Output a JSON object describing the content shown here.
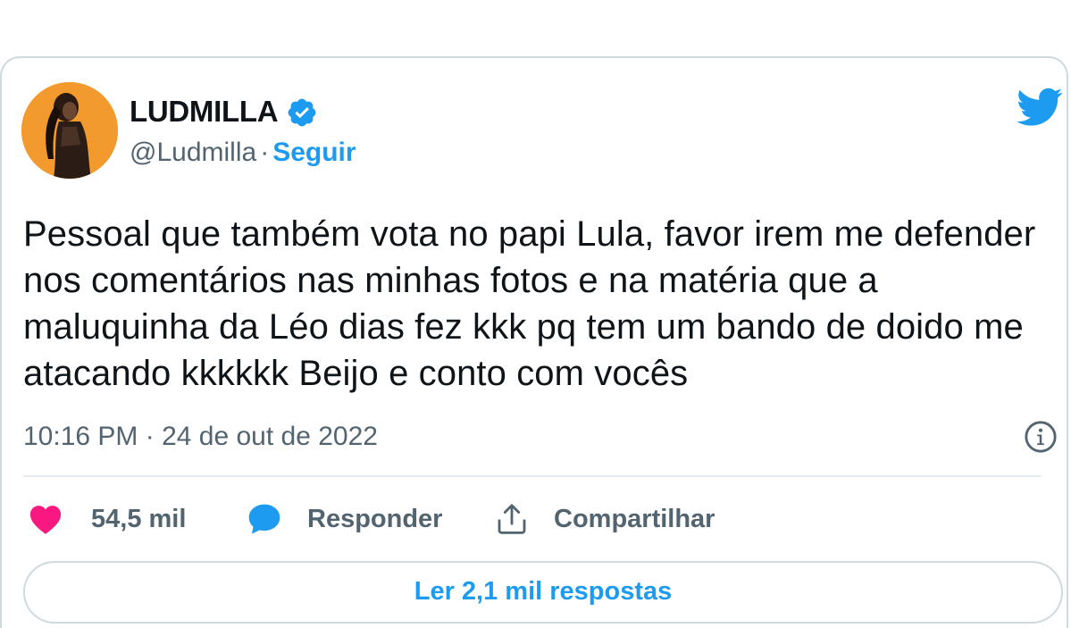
{
  "tweet": {
    "author": {
      "display_name": "LUDMILLA",
      "handle": "@Ludmilla",
      "separator": "·",
      "follow_label": "Seguir",
      "verified": true
    },
    "text": "Pessoal que também vota no papi Lula, favor irem me defender nos comentários nas minhas fotos e na matéria que a maluquinha da Léo dias fez kkk pq tem um bando de doido me atacando kkkkkk Beijo e conto com vocês",
    "timestamp": "10:16 PM · 24 de out de 2022",
    "likes": "54,5 mil",
    "reply_label": "Responder",
    "share_label": "Compartilhar",
    "read_replies_label": "Ler 2,1 mil respostas"
  },
  "icons": {
    "brand": "twitter-bird-icon",
    "verified": "verified-badge-icon",
    "info": "info-icon",
    "like": "heart-icon",
    "reply": "speech-bubble-icon",
    "share": "share-upload-icon"
  },
  "colors": {
    "accent": "#1d9bf0",
    "like": "#f91880",
    "secondary_text": "#536471",
    "primary_text": "#0f1419",
    "border": "#cfd9de",
    "avatar_bg": "#f29a2e"
  }
}
